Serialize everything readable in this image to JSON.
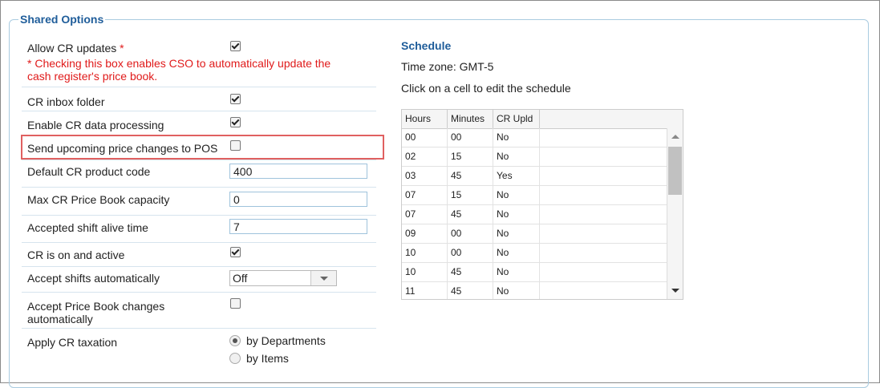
{
  "section": {
    "title": "Shared Options"
  },
  "options": {
    "allow_cr_updates": {
      "label": "Allow CR updates",
      "required_mark": "*",
      "checked": true,
      "note": "* Checking this box enables CSO to automatically update the cash register's price book."
    },
    "cr_inbox_folder": {
      "label": "CR inbox folder",
      "checked": true
    },
    "enable_cr_data_processing": {
      "label": "Enable CR data processing",
      "checked": true
    },
    "send_upcoming_price_changes": {
      "label": "Send upcoming price changes to POS",
      "checked": false
    },
    "default_cr_product_code": {
      "label": "Default CR product code",
      "value": "400"
    },
    "max_cr_price_book_capacity": {
      "label": "Max CR Price Book capacity",
      "value": "0"
    },
    "accepted_shift_alive_time": {
      "label": "Accepted shift alive time",
      "value": "7"
    },
    "cr_is_on_and_active": {
      "label": "CR is on and active",
      "checked": true
    },
    "accept_shifts_automatically": {
      "label": "Accept shifts automatically",
      "selected": "Off"
    },
    "accept_price_book_changes": {
      "label": "Accept Price Book changes automatically",
      "checked": false
    },
    "apply_cr_taxation": {
      "label": "Apply CR taxation",
      "options": [
        {
          "label": "by Departments",
          "checked": true
        },
        {
          "label": "by Items",
          "checked": false
        }
      ]
    }
  },
  "schedule": {
    "title": "Schedule",
    "timezone": "Time zone: GMT-5",
    "instruction": "Click on a cell to edit the schedule",
    "columns": [
      "Hours",
      "Minutes",
      "CR Upld"
    ],
    "rows": [
      [
        "00",
        "00",
        "No"
      ],
      [
        "02",
        "15",
        "No"
      ],
      [
        "03",
        "45",
        "Yes"
      ],
      [
        "07",
        "15",
        "No"
      ],
      [
        "07",
        "45",
        "No"
      ],
      [
        "09",
        "00",
        "No"
      ],
      [
        "10",
        "00",
        "No"
      ],
      [
        "10",
        "45",
        "No"
      ],
      [
        "11",
        "45",
        "No"
      ]
    ]
  }
}
